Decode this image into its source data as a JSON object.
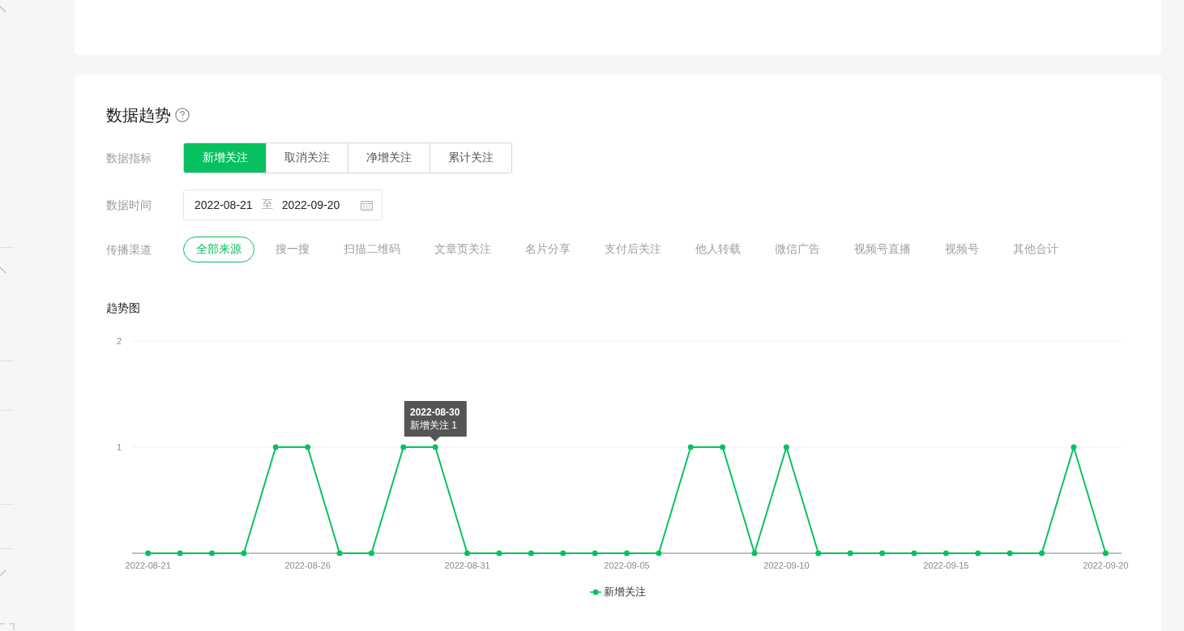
{
  "trend_panel": {
    "title": "数据趋势",
    "filters": [
      {
        "kind": "segmented",
        "label": "数据指标",
        "options": [
          {
            "label": "新增关注",
            "selected": true
          },
          {
            "label": "取消关注",
            "selected": false
          },
          {
            "label": "净增关注",
            "selected": false
          },
          {
            "label": "累计关注",
            "selected": false
          }
        ]
      },
      {
        "kind": "date_range",
        "label": "数据时间",
        "start": "2022-08-21",
        "separator": "至",
        "end": "2022-09-20"
      },
      {
        "kind": "chips",
        "label": "传播渠道",
        "options": [
          {
            "label": "全部来源",
            "selected": true
          },
          {
            "label": "搜一搜",
            "selected": false
          },
          {
            "label": "扫描二维码",
            "selected": false
          },
          {
            "label": "文章页关注",
            "selected": false
          },
          {
            "label": "名片分享",
            "selected": false
          },
          {
            "label": "支付后关注",
            "selected": false
          },
          {
            "label": "他人转载",
            "selected": false
          },
          {
            "label": "微信广告",
            "selected": false
          },
          {
            "label": "视频号直播",
            "selected": false
          },
          {
            "label": "视频号",
            "selected": false
          },
          {
            "label": "其他合计",
            "selected": false
          }
        ]
      }
    ],
    "chart_title": "趋势图",
    "chart_data": {
      "type": "line",
      "categories": [
        "2022-08-21",
        null,
        null,
        null,
        null,
        "2022-08-26",
        null,
        null,
        null,
        null,
        "2022-08-31",
        null,
        null,
        null,
        null,
        "2022-09-05",
        null,
        null,
        null,
        null,
        "2022-09-10",
        null,
        null,
        null,
        null,
        "2022-09-15",
        null,
        null,
        null,
        null,
        "2022-09-20"
      ],
      "series": [
        {
          "name": "新增关注",
          "color": "#07c160",
          "marker": "circle",
          "values": [
            0,
            0,
            0,
            0,
            1,
            1,
            0,
            0,
            1,
            1,
            0,
            0,
            0,
            0,
            0,
            0,
            0,
            1,
            1,
            0,
            1,
            0,
            0,
            0,
            0,
            0,
            0,
            0,
            0,
            1,
            0
          ]
        }
      ],
      "ylim": [
        0,
        2
      ],
      "yticks": [
        1,
        2
      ]
    },
    "tooltip": {
      "title": "2022-08-30",
      "text": "新增关注 1"
    }
  }
}
